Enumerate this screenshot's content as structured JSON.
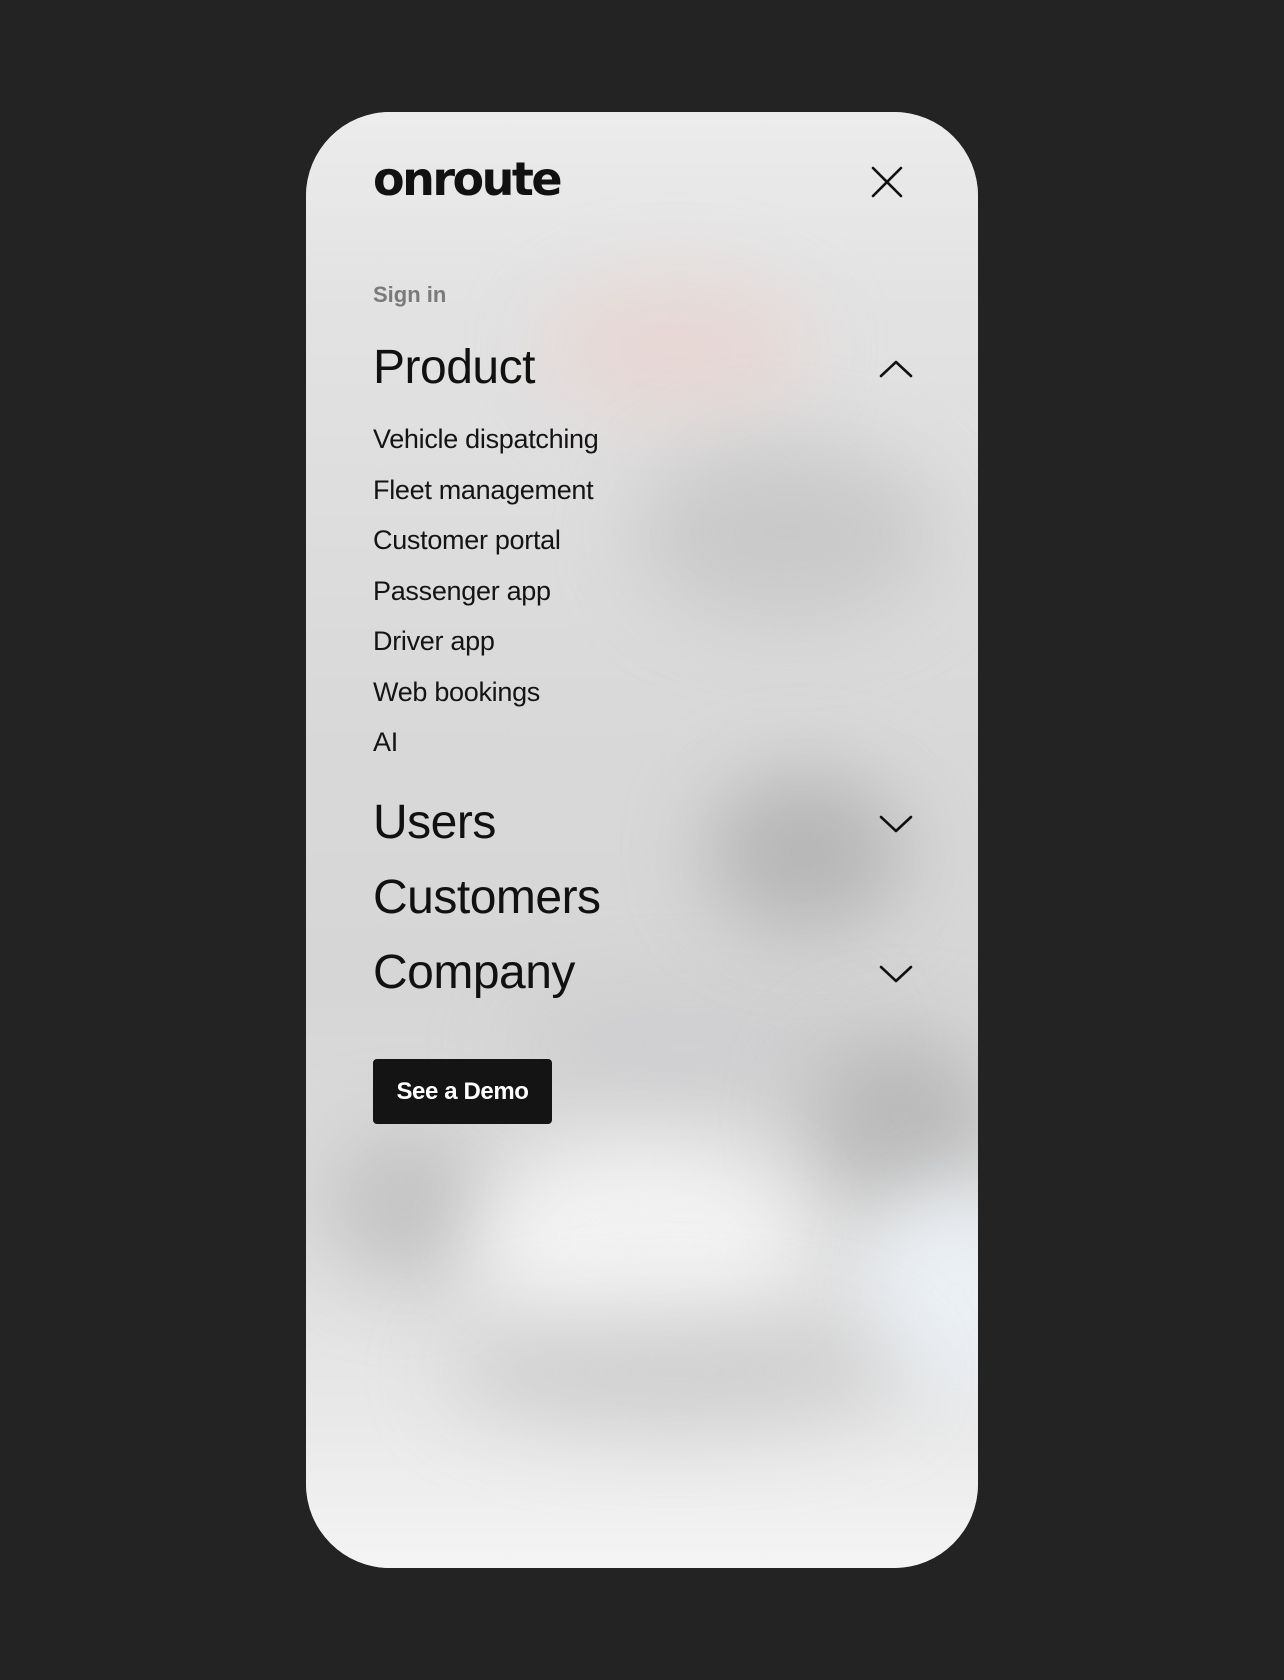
{
  "brand": {
    "logo_text": "onroute"
  },
  "menu": {
    "sign_in": "Sign in",
    "sections": [
      {
        "label": "Product",
        "expanded": true,
        "has_toggle": true
      },
      {
        "label": "Users",
        "expanded": false,
        "has_toggle": true
      },
      {
        "label": "Customers",
        "expanded": false,
        "has_toggle": false
      },
      {
        "label": "Company",
        "expanded": false,
        "has_toggle": true
      }
    ],
    "product_items": [
      "Vehicle dispatching",
      "Fleet management",
      "Customer portal",
      "Passenger app",
      "Driver app",
      "Web bookings",
      "AI"
    ]
  },
  "cta": {
    "label": "See a Demo"
  },
  "icons": {
    "close": "close-icon",
    "expanded": "chevron-up-icon",
    "collapsed": "chevron-down-icon"
  },
  "colors": {
    "page_background": "#232323",
    "text": "#111111",
    "muted_text": "#7a7a7a",
    "button_background": "#141414",
    "button_text": "#ffffff"
  }
}
